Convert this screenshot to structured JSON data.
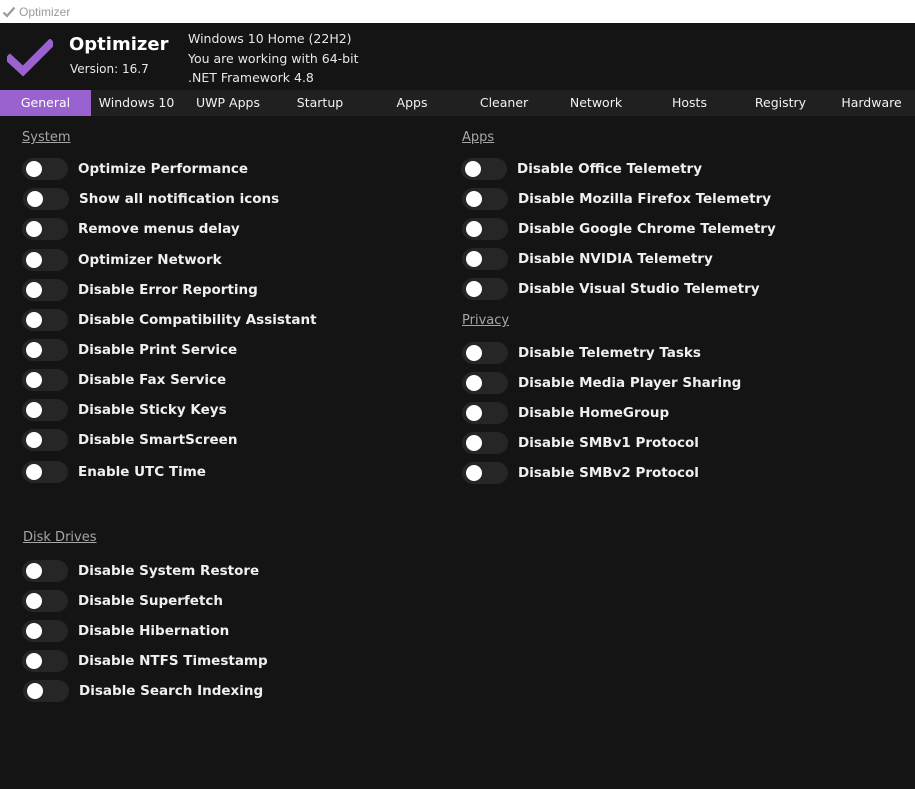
{
  "window": {
    "title": "Optimizer",
    "title_icon": "checkmark-icon"
  },
  "header": {
    "app_name": "Optimizer",
    "version": "Version: 16.7",
    "os_info": "Windows 10 Home (22H2)",
    "arch_info": "You are working with 64-bit",
    "framework_info": ".NET Framework 4.8",
    "logo_icon": "checkmark-icon",
    "accent_color": "#9a62cf"
  },
  "tabs": [
    {
      "label": "General",
      "active": true
    },
    {
      "label": "Windows 10",
      "active": false
    },
    {
      "label": "UWP Apps",
      "active": false
    },
    {
      "label": "Startup",
      "active": false
    },
    {
      "label": "Apps",
      "active": false
    },
    {
      "label": "Cleaner",
      "active": false
    },
    {
      "label": "Network",
      "active": false
    },
    {
      "label": "Hosts",
      "active": false
    },
    {
      "label": "Registry",
      "active": false
    },
    {
      "label": "Hardware",
      "active": false
    }
  ],
  "sections": {
    "system": {
      "title": "System",
      "options": [
        {
          "label": "Optimize Performance",
          "enabled": false
        },
        {
          "label": "Show all notification icons",
          "enabled": false
        },
        {
          "label": "Remove menus delay",
          "enabled": false
        },
        {
          "label": "Optimizer Network",
          "enabled": false
        },
        {
          "label": "Disable Error Reporting",
          "enabled": false
        },
        {
          "label": "Disable Compatibility Assistant",
          "enabled": false
        },
        {
          "label": "Disable Print Service",
          "enabled": false
        },
        {
          "label": "Disable Fax Service",
          "enabled": false
        },
        {
          "label": "Disable Sticky Keys",
          "enabled": false
        },
        {
          "label": "Disable SmartScreen",
          "enabled": false
        },
        {
          "label": "Enable UTC Time",
          "enabled": false
        }
      ]
    },
    "apps": {
      "title": "Apps",
      "options": [
        {
          "label": "Disable Office Telemetry",
          "enabled": false
        },
        {
          "label": "Disable Mozilla Firefox Telemetry",
          "enabled": false
        },
        {
          "label": "Disable Google Chrome Telemetry",
          "enabled": false
        },
        {
          "label": "Disable NVIDIA Telemetry",
          "enabled": false
        },
        {
          "label": "Disable Visual Studio Telemetry",
          "enabled": false
        }
      ]
    },
    "privacy": {
      "title": "Privacy",
      "options": [
        {
          "label": "Disable Telemetry Tasks",
          "enabled": false
        },
        {
          "label": "Disable Media Player Sharing",
          "enabled": false
        },
        {
          "label": "Disable HomeGroup",
          "enabled": false
        },
        {
          "label": "Disable SMBv1 Protocol",
          "enabled": false
        },
        {
          "label": "Disable SMBv2 Protocol",
          "enabled": false
        }
      ]
    },
    "disk": {
      "title": "Disk Drives",
      "options": [
        {
          "label": "Disable System Restore",
          "enabled": false
        },
        {
          "label": "Disable Superfetch",
          "enabled": false
        },
        {
          "label": "Disable Hibernation",
          "enabled": false
        },
        {
          "label": "Disable NTFS Timestamp",
          "enabled": false
        },
        {
          "label": "Disable Search Indexing",
          "enabled": false
        }
      ]
    }
  }
}
